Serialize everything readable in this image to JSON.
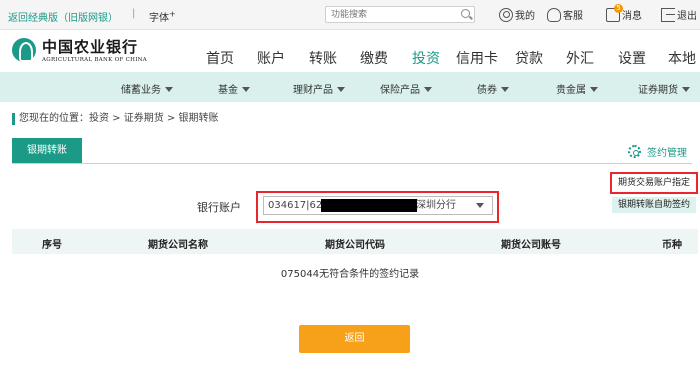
{
  "topbar": {
    "classic_link": "返回经典版（旧版网银）",
    "separator": "|",
    "font_size_label": "字体",
    "font_size_plus": "+",
    "search_placeholder": "功能搜索",
    "my_label": "我的",
    "service_label": "客服",
    "message_label": "消息",
    "message_count": "5",
    "logout_label": "退出"
  },
  "logo": {
    "name_cn": "中国农业银行",
    "name_en": "AGRICULTURAL BANK OF CHINA"
  },
  "main_nav": [
    {
      "label": "首页"
    },
    {
      "label": "账户"
    },
    {
      "label": "转账"
    },
    {
      "label": "缴费"
    },
    {
      "label": "投资",
      "active": true
    },
    {
      "label": "信用卡"
    },
    {
      "label": "贷款"
    },
    {
      "label": "外汇"
    },
    {
      "label": "设置"
    },
    {
      "label": "本地"
    }
  ],
  "sub_nav": [
    {
      "label": "储蓄业务"
    },
    {
      "label": "基金"
    },
    {
      "label": "理财产品"
    },
    {
      "label": "保险产品"
    },
    {
      "label": "债券"
    },
    {
      "label": "贵金属"
    },
    {
      "label": "证券期货"
    }
  ],
  "breadcrumb": "您现在的位置：投资 > 证券期货 > 银期转账",
  "tab": {
    "active_label": "银期转账",
    "sign_manage_label": "签约管理"
  },
  "buttons": {
    "designate_label": "期货交易账户指定",
    "self_sign_label": "银期转账自助签约",
    "back_label": "返回"
  },
  "account": {
    "label": "银行账户",
    "value_prefix": "034617|6228",
    "value_branch": "深圳分行"
  },
  "table": {
    "columns": [
      "序号",
      "期货公司名称",
      "期货公司代码",
      "期货公司账号",
      "币种"
    ],
    "empty_message": "075044无符合条件的签约记录"
  },
  "colors": {
    "accent": "#1b9a87",
    "highlight_border": "#e8262b",
    "back_button": "#f7a11a",
    "subnav_bg": "#d9f0ec"
  }
}
